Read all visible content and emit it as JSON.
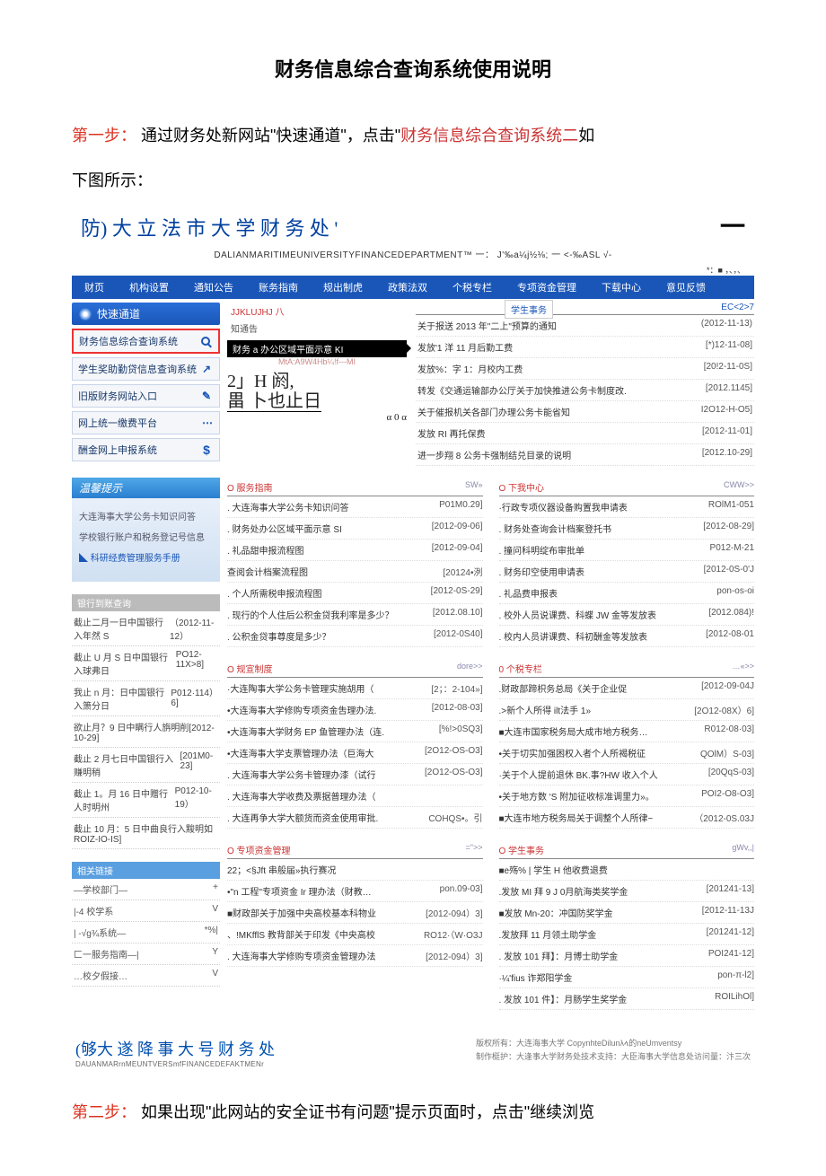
{
  "doc": {
    "title": "财务信息综合查询系统使用说明",
    "step1_label": "第一步：",
    "step1_a": "通过财务处新网站\"快速通道\"，点击\"",
    "step1_link": "财务信息综合查询系统二",
    "step1_b": "如",
    "step1_c": "下图所示：",
    "step2_label": "第二步：",
    "step2_text": "如果出现\"此网站的安全证书有问题\"提示页面时，点击\"继续浏览"
  },
  "site": {
    "title": "防) 大 立 法 市 大 学 财 务 处 '",
    "dash": "一",
    "sub": "DALIANMARITIMEUNIVERSITYFINANCEDEPARTMENT™",
    "sub2a": "一：  J'‰a¼j½⅛;",
    "sub2b": "一 <-‰ASL √-",
    "meta": "*：■ ，、，、"
  },
  "nav": {
    "items": [
      "财页",
      "机构设置",
      "通知公告",
      "账务指南",
      "规出制虎",
      "政策法双",
      "个税专栏",
      "专项资金管理",
      "下载中心",
      "意见反馈"
    ],
    "dropdown": "学生事务"
  },
  "quick": {
    "header": "快速通道",
    "items": [
      {
        "label": "财务信息综合查询系统",
        "icon": "mag",
        "hl": true
      },
      {
        "label": "学生奖助勤贷信息查询系统",
        "icon": "share",
        "hl": false
      },
      {
        "label": "旧版财务网站入口",
        "icon": "edit",
        "hl": false
      },
      {
        "label": "网上统一缴费平台",
        "icon": "dots",
        "hl": false
      },
      {
        "label": "酬金网上申报系统",
        "icon": "dollar",
        "hl": false
      }
    ]
  },
  "tips": {
    "header": "温馨提示",
    "items": [
      "大连海事大学公务卡知识问答",
      "学校银行账户和税务登记号信息",
      "◣ 科研经费管理服务手册"
    ]
  },
  "bank": {
    "header": "银行到账查询",
    "rows": [
      {
        "t": "截止二月一日中国银行入年然 S",
        "d": "（2012-11-12）"
      },
      {
        "t": "截止 U 月 S 日中国银行入球弗日",
        "d": "PO12-11X>8]"
      },
      {
        "t": "我止 n 月：日中国银行入箫分日",
        "d": "P012·114）6]"
      },
      {
        "t": "欲止月？9 日中瞒行人旃明削[2012-10-29]",
        "d": ""
      },
      {
        "t": "截止 2 月七日中国银行入赚明稍",
        "d": "[201M0-23]"
      },
      {
        "t": "截止 1。月 16 日中赠行人时明州",
        "d": "P012-10-19）"
      },
      {
        "t": "截止 10 月：5 日中曲良行入黢明如ROIZ-IO-IS]",
        "d": ""
      }
    ]
  },
  "links": {
    "header": "相关链接",
    "more": "=\">>",
    "rows": [
      {
        "t": "—学校部门—",
        "d": "+"
      },
      {
        "t": "|-4 校学系",
        "d": "V"
      },
      {
        "t": "| -√g¾系统—",
        "d": "*%|"
      },
      {
        "t": "匚一服务指南—|",
        "d": "Y"
      },
      {
        "t": "…校夕假接…",
        "d": "V"
      }
    ]
  },
  "notice": {
    "header_a": "JJKLUJHJ 八",
    "header_b": "知通告",
    "bubble": "财务 a 办公区域平面示意 KI",
    "bubble_sub": "MtA:A9W4Hb¼!f---MI",
    "ph_a": "2」H 阏,",
    "ph_b": "畕 卜也止日",
    "ph_c": "α 0 α",
    "top_more": "EC<2>7",
    "rows": [
      {
        "t": "关于报送 2013 年\"二上\"预算的通知",
        "d": "(2012-11-13)"
      },
      {
        "t": "发放'1 洋 11 月后勤工费",
        "d": "[*)12-11-08]"
      },
      {
        "t": "发放%：字 1：月校内工费",
        "d": "[20!2-11-0S]"
      },
      {
        "t": "转发《交通运输部办公厅关于加快推进公务卡制度改.",
        "d": "[2012.1145]"
      },
      {
        "t": "关于催报机关各部门办理公务卡能省知",
        "d": "I2O12-H-O5]"
      },
      {
        "t": "发放 RI 再托保费",
        "d": "[2012-11-01]"
      },
      {
        "t": "进一步翔 8 公务卡强制结兑目录的说明",
        "d": "[2012.10-29]"
      }
    ]
  },
  "sec_guide": {
    "title": "O 服务指南",
    "more": "SW»",
    "rows": [
      {
        "t": ". 大连海事大学公务卡知识问答",
        "d": "P01M0.29]"
      },
      {
        "t": ". 财务处办公区域平面示意 SI",
        "d": "[2012-09-06]"
      },
      {
        "t": ". 礼品甜申报流程图",
        "d": "[2012-09-04]"
      },
      {
        "t": "查阅会计档案流程图",
        "d": "[20124•洌"
      },
      {
        "t": ". 个人所需税申报流程图",
        "d": "[2012-0S-29]"
      },
      {
        "t": ". 现行的个人住后公积金贷我利率是多少？",
        "d": "[2012.08.10]"
      },
      {
        "t": ". 公积金贷事尊度是多少？",
        "d": "[2012-0S40]"
      }
    ]
  },
  "sec_download": {
    "title": "O 下我中心",
    "more": "CWW>>",
    "rows": [
      {
        "t": "·行政专项仪器设备购置我申请表",
        "d": "ROlM1-051"
      },
      {
        "t": ". 财务处查询会计档案登托书",
        "d": "[2012-08-29]"
      },
      {
        "t": ". 撞问科明绽布审批单",
        "d": "P012-M-21"
      },
      {
        "t": ". 财务印空使用申请表",
        "d": "[2012-0S-0'J"
      },
      {
        "t": ". 礼品费申报表",
        "d": "pon-os-oi"
      },
      {
        "t": ". 校外人员说课费、科蝶 JW 金等发放表",
        "d": "[2012.084)!"
      },
      {
        "t": ". 校内人员讲课费、科初酬金等发放表",
        "d": "[2012-08-01"
      }
    ]
  },
  "sec_rules": {
    "title": "O 规宣制度",
    "more": "dore>>",
    "rows": [
      {
        "t": "·大连陶事大学公务卡管理实施胡用（",
        "d": "[2；：2-104»]"
      },
      {
        "t": "•大连海事大学修购专项资金吿理办法.",
        "d": "[2012-08-03]"
      },
      {
        "t": "•大连海事大学财务 EP 鱼管理办法（连.",
        "d": "[%!>0SQ3]"
      },
      {
        "t": "•大连海事大学支票管理办法（巨海大",
        "d": "[2O12-OS-O3]"
      },
      {
        "t": ". 大连海事大学公务卡管理办漆（试行",
        "d": "[2O12-OS-O3]"
      },
      {
        "t": ". 大连海事大学收费及票据普理办法（",
        "d": ""
      },
      {
        "t": ". 大连再争大学大额货而资金使用审批.",
        "d": "COHQS•。引"
      }
    ]
  },
  "sec_tax": {
    "title": "0 个税专栏",
    "more": "…«>>",
    "rows": [
      {
        "t": ".财政部蹄枳务总局《关于企业促",
        "d": "[2012-09-04J"
      },
      {
        "t": ".>新个人所得 ilt法手 1»",
        "d": "[2O12-08X）6]"
      },
      {
        "t": "■大连市国家税务局大成市地方税务…",
        "d": "R012-08·03]"
      },
      {
        "t": "•关于切实加强困权入者个人所褐税征",
        "d": "QOlM）S-03]"
      },
      {
        "t": "·关于个人提前退休 BK.事?HW 收入个人",
        "d": "[20QqS-03]"
      },
      {
        "t": "•关于地方数 'S 附加征收标准调里力»。",
        "d": "POI2-O8-O3]"
      },
      {
        "t": "■大连市地方税务局关于调整个人所律~",
        "d": "（2012-0S.03J"
      }
    ]
  },
  "sec_fund": {
    "title": "O 专项资金管理",
    "more": "=\">>",
    "rows": [
      {
        "t": "22；<§Jft 串般届»执行赛况",
        "d": ""
      },
      {
        "t": "•\"n 工程\"专项资金 Ir 理办法（财教…",
        "d": "pon.09-03]"
      },
      {
        "t": "■财政部关于加强中央高校基本科物业",
        "d": "[2012-094）3]"
      },
      {
        "t": "、!MKfflS 教背部关于印发《中央高校",
        "d": "RO12·（W·O3J"
      },
      {
        "t": ". 大连海事大学修购专项资金管理办法",
        "d": "[2012-094）3]"
      }
    ]
  },
  "sec_student": {
    "title": "O 学生事务",
    "more": "gWv,,|",
    "rows": [
      {
        "t": "■e殇% | 学生 H 他收费退费",
        "d": ""
      },
      {
        "t": ".发放 MI 拜 9 J 0月航海类奖学金",
        "d": "[201241-13]"
      },
      {
        "t": "■发放 Mn-20：冲国防奖学金",
        "d": "[2012-11-13J"
      },
      {
        "t": ".发放拜 11 月领土助学金",
        "d": "[201241-12]"
      },
      {
        "t": ". 发放 101 拜】：月博士助学金",
        "d": "POI241-12]"
      },
      {
        "t": "·¼'fius 诈郑阳学金",
        "d": "pon-π-l2]"
      },
      {
        "t": ". 发放 101 件】：月肠学生奖学金",
        "d": "ROILihOl]"
      }
    ]
  },
  "footer": {
    "title": "(够大 遂 降 事 大 号 财 务 处",
    "sub": "DAUANMARrnMEUNTVERSmfFINANCEDEFAKTMENr",
    "copy": "版权所有：大连海事大学 CopynhteDilunλላ的neUmventsy",
    "tech": "制作梃护：大逢事大学财务处技术支持：大臣海事大学信息处访问量：汴三次"
  }
}
